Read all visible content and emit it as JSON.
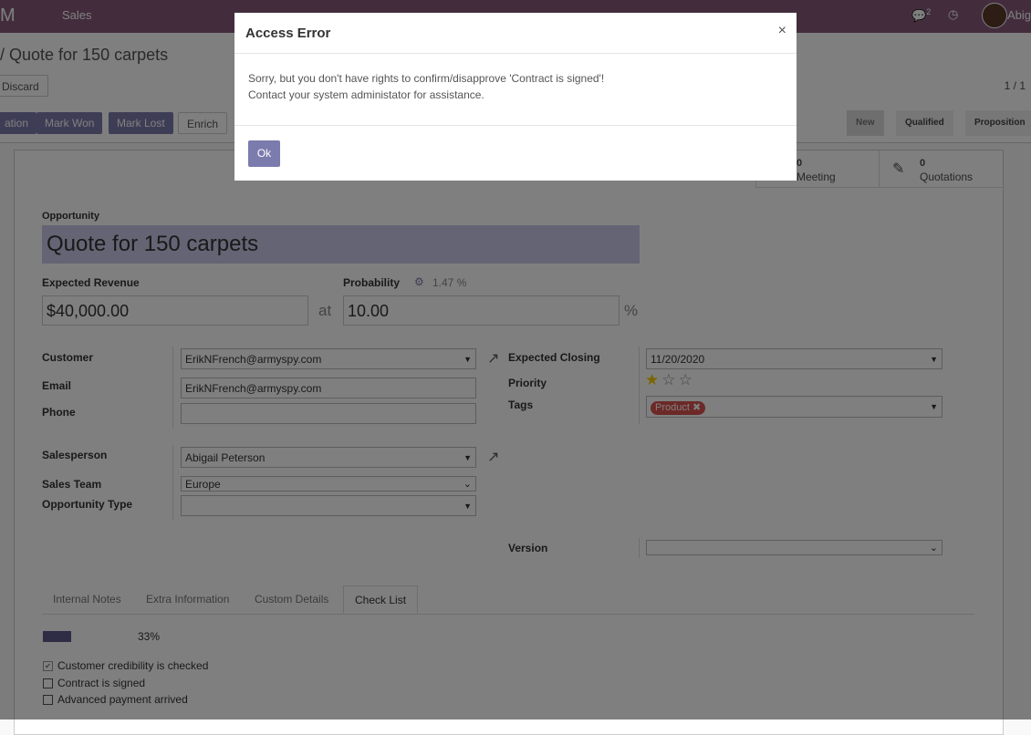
{
  "topbar": {
    "brand": "M",
    "menu": "Sales",
    "chat_count": "2",
    "user_name": "Abig"
  },
  "control_panel": {
    "breadcrumb": "/ Quote for 150 carpets",
    "discard": "Discard",
    "pager": "1 / 1",
    "buttons": [
      "ation",
      "Mark Won",
      "Mark Lost",
      "Enrich"
    ],
    "stages": [
      "New",
      "Qualified",
      "Proposition"
    ]
  },
  "smart_buttons": {
    "meeting_count": "0",
    "meeting_label": "Meeting",
    "quotations_count": "0",
    "quotations_label": "Quotations"
  },
  "form": {
    "opportunity_label": "Opportunity",
    "opportunity_value": "Quote for 150 carpets",
    "revenue_label": "Expected Revenue",
    "revenue_value": "$40,000.00",
    "at_label": "at",
    "probability_label": "Probability",
    "probability_auto": "1.47 %",
    "probability_value": "10.00",
    "percent_sign": "%",
    "customer_label": "Customer",
    "customer_value": "ErikNFrench@armyspy.com",
    "email_label": "Email",
    "email_value": "ErikNFrench@armyspy.com",
    "phone_label": "Phone",
    "phone_value": "",
    "closing_label": "Expected Closing",
    "closing_value": "11/20/2020",
    "priority_label": "Priority",
    "priority_stars": 1,
    "priority_max": 3,
    "tags_label": "Tags",
    "tag_value": "Product",
    "salesperson_label": "Salesperson",
    "salesperson_value": "Abigail Peterson",
    "team_label": "Sales Team",
    "team_value": "Europe",
    "type_label": "Opportunity Type",
    "type_value": "",
    "version_label": "Version",
    "version_value": ""
  },
  "tabs": [
    "Internal Notes",
    "Extra Information",
    "Custom Details",
    "Check List"
  ],
  "active_tab": "Check List",
  "checklist": {
    "progress_text": "33%",
    "progress": 0.33,
    "items": [
      {
        "label": "Customer credibility is checked",
        "checked": true
      },
      {
        "label": "Contract is signed",
        "checked": false
      },
      {
        "label": "Advanced payment arrived",
        "checked": false
      }
    ]
  },
  "dialog": {
    "title": "Access Error",
    "close": "×",
    "line1": "Sorry, but you don't have rights to confirm/disapprove 'Contract is signed'!",
    "line2": "Contact your system administator for assistance.",
    "ok": "Ok"
  },
  "colors": {
    "brand": "#875a7b",
    "primary": "#7c7bad",
    "tag": "#d9534f",
    "star": "#f3cc00"
  }
}
